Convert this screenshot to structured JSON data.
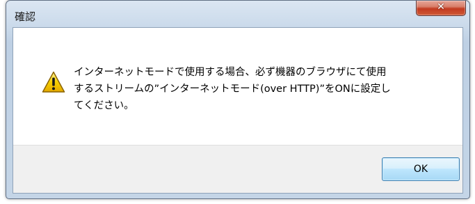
{
  "window": {
    "title": "確認",
    "close_symbol": "✕"
  },
  "message": {
    "lines": [
      "インターネットモードで使用する場合、必ず機器のブラウザにて使用",
      "するストリームの”インターネットモード(over HTTP)”をONに設定し",
      "てください。"
    ]
  },
  "buttons": {
    "ok_label": "OK"
  },
  "icons": {
    "warning": "warning-icon",
    "close": "close-icon"
  },
  "colors": {
    "title_bar": "#c9d9ea",
    "close_button": "#c23a20",
    "warning_yellow": "#f5c400",
    "ok_button_border": "#3c7fb1",
    "button_area": "#f0f0f0"
  }
}
